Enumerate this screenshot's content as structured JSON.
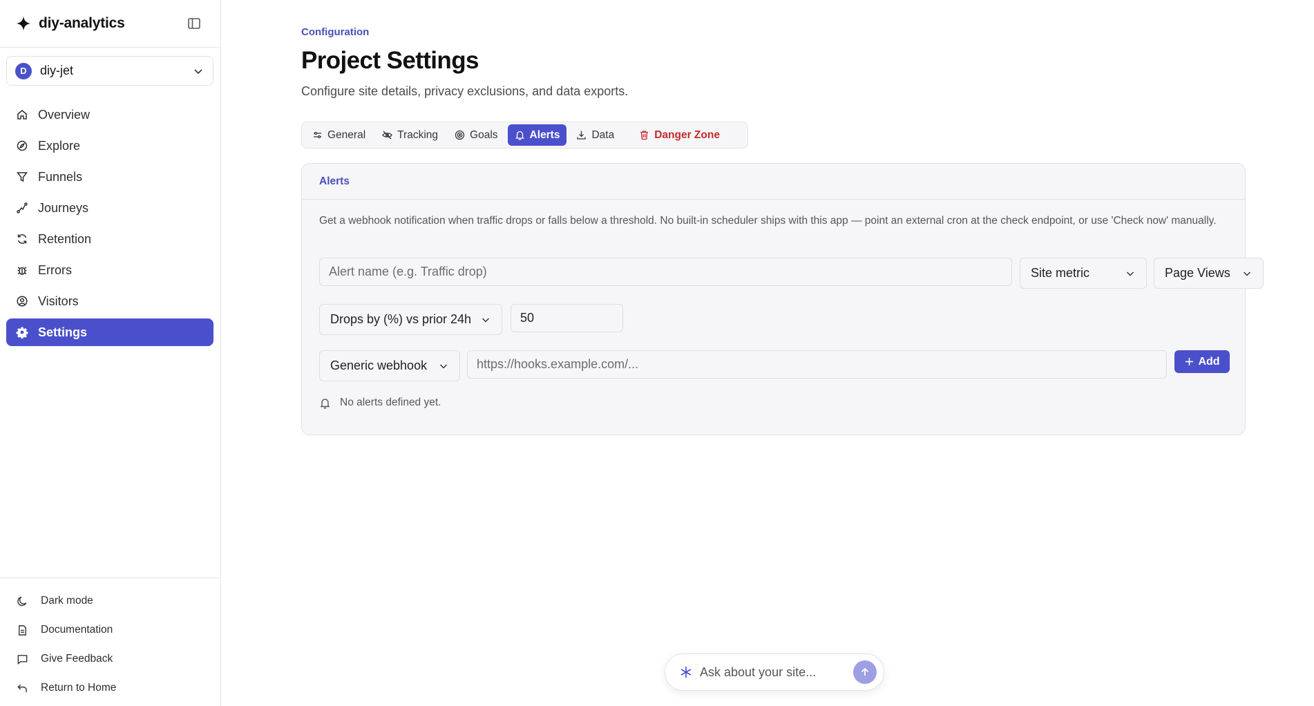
{
  "brand": {
    "name": "diy-analytics"
  },
  "project": {
    "initial": "D",
    "name": "diy-jet"
  },
  "sidebar": {
    "items": [
      {
        "label": "Overview",
        "icon": "home-icon"
      },
      {
        "label": "Explore",
        "icon": "compass-icon"
      },
      {
        "label": "Funnels",
        "icon": "filter-icon"
      },
      {
        "label": "Journeys",
        "icon": "route-icon"
      },
      {
        "label": "Retention",
        "icon": "refresh-icon"
      },
      {
        "label": "Errors",
        "icon": "bug-icon"
      },
      {
        "label": "Visitors",
        "icon": "user-circle-icon"
      },
      {
        "label": "Settings",
        "icon": "gear-icon",
        "active": true
      }
    ],
    "footer": [
      {
        "label": "Dark mode",
        "icon": "moon-icon"
      },
      {
        "label": "Documentation",
        "icon": "document-icon"
      },
      {
        "label": "Give Feedback",
        "icon": "message-icon"
      },
      {
        "label": "Return to Home",
        "icon": "return-icon"
      }
    ]
  },
  "header": {
    "eyebrow": "Configuration",
    "title": "Project Settings",
    "subtitle": "Configure site details, privacy exclusions, and data exports."
  },
  "tabs": [
    {
      "label": "General",
      "icon": "sliders-icon"
    },
    {
      "label": "Tracking",
      "icon": "eye-off-icon"
    },
    {
      "label": "Goals",
      "icon": "target-icon"
    },
    {
      "label": "Alerts",
      "icon": "bell-icon",
      "active": true
    },
    {
      "label": "Data",
      "icon": "download-icon"
    },
    {
      "label": "Danger Zone",
      "icon": "trash-icon",
      "danger": true
    }
  ],
  "alerts": {
    "card_title": "Alerts",
    "description": "Get a webhook notification when traffic drops or falls below a threshold. No built-in scheduler ships with this app — point an external cron at the check endpoint, or use 'Check now' manually.",
    "name_placeholder": "Alert name (e.g. Traffic drop)",
    "scope_select": "Site metric",
    "metric_select": "Page Views",
    "condition_select": "Drops by (%) vs prior 24h",
    "threshold_value": "50",
    "channel_select": "Generic webhook",
    "url_placeholder": "https://hooks.example.com/...",
    "add_label": "Add",
    "empty_text": "No alerts defined yet."
  },
  "ask": {
    "placeholder": "Ask about your site..."
  },
  "colors": {
    "accent": "#4a4fcb",
    "accent_text": "#4a4fb8",
    "danger": "#c22b2b",
    "send_button": "#9c9fe3"
  }
}
